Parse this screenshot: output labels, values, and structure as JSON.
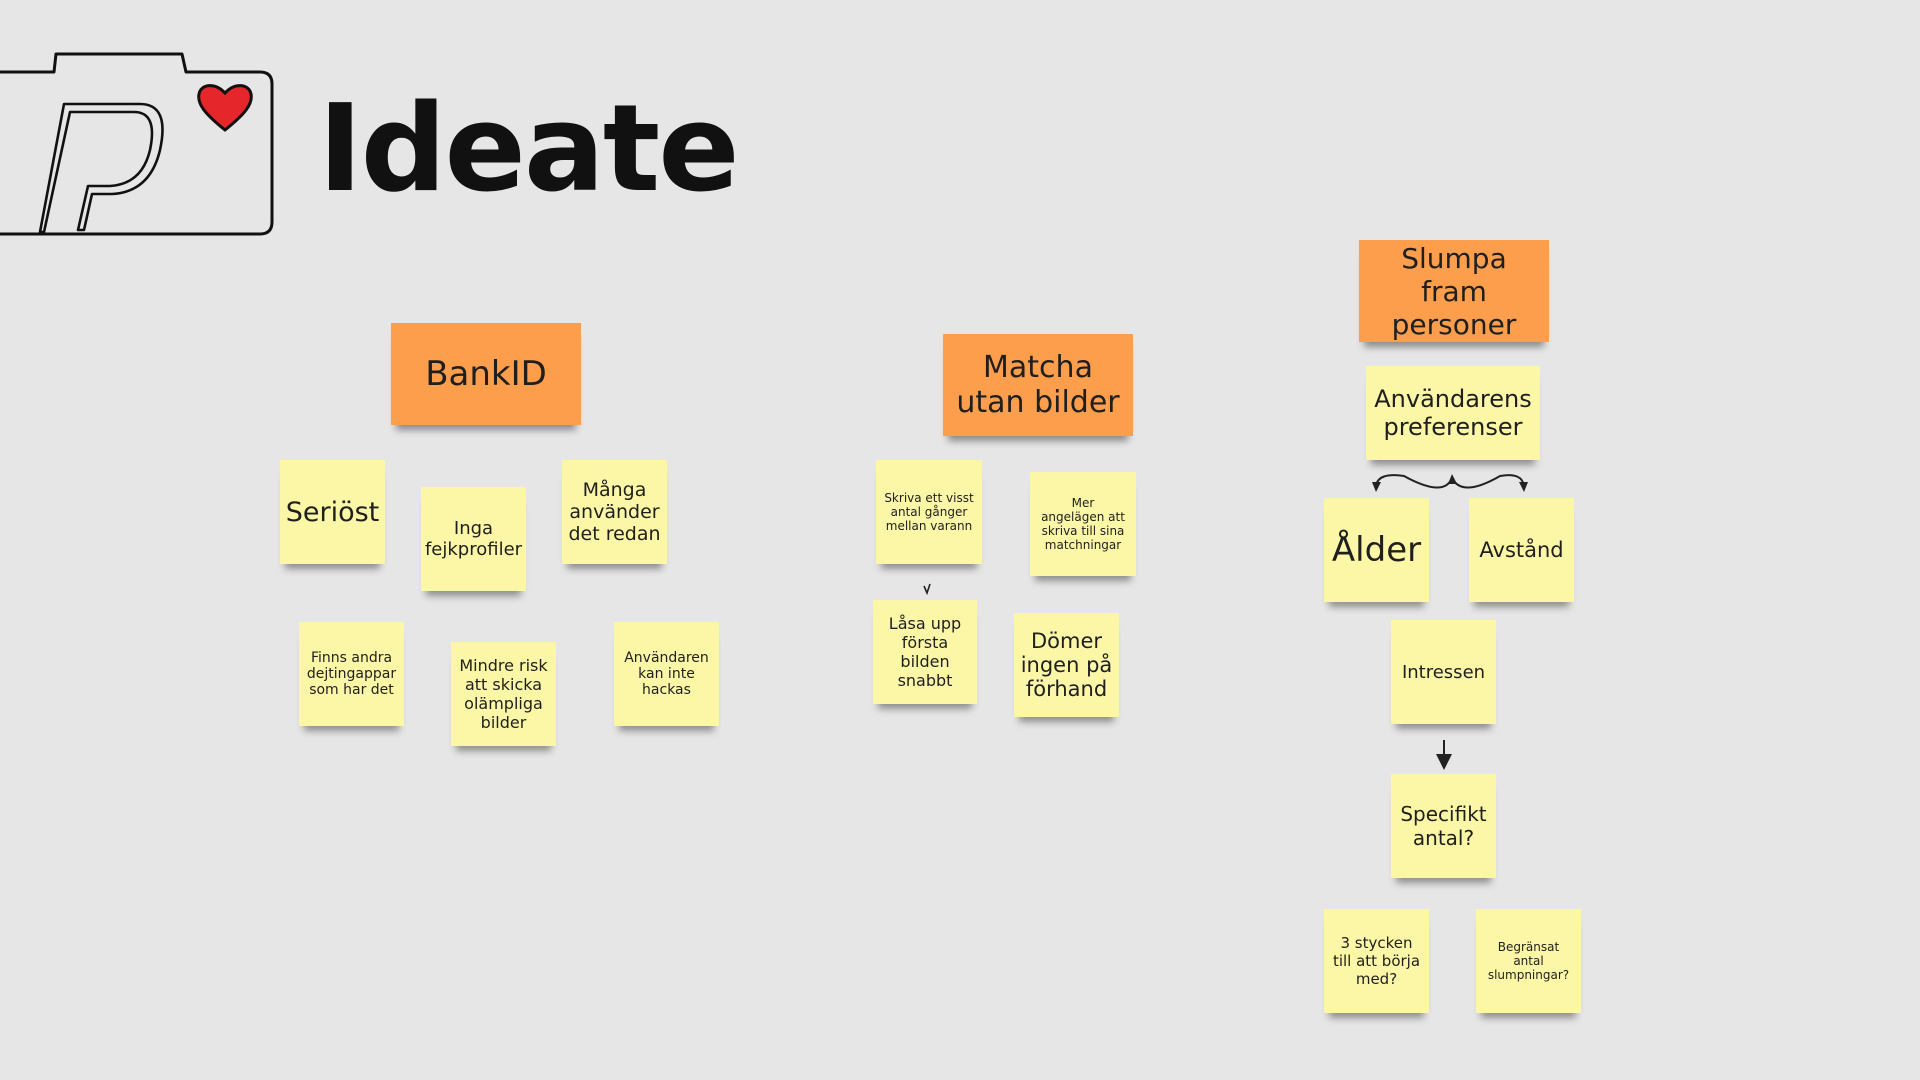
{
  "title": "Ideate",
  "logo": {
    "icon": "camera-heart-logo",
    "heart_color": "#e5262a"
  },
  "colors": {
    "background": "#e6e6e6",
    "yellow_note": "#fcf7a6",
    "orange_note": "#fd9e4c"
  },
  "clusters": {
    "bankid": {
      "header": "BankID",
      "notes": [
        "Seriöst",
        "Inga\nfejkprofiler",
        "Många\nanvänder\ndet redan",
        "Finns andra\ndejtingappar\nsom har det",
        "Mindre risk\natt skicka\nolämpliga\nbilder",
        "Användaren\nkan inte\nhackas"
      ]
    },
    "match": {
      "header": "Matcha\nutan bilder",
      "notes": [
        "Skriva ett visst\nantal gånger\nmellan varann",
        "Mer\nangelägen att\nskriva till sina\nmatchningar",
        "Låsa upp\nförsta\nbilden\nsnabbt",
        "Dömer\ningen på\nförhand"
      ]
    },
    "random": {
      "header": "Slumpa fram\npersoner",
      "notes": [
        "Användarens\npreferenser",
        "Ålder",
        "Avstånd",
        "Intressen",
        "Specifikt\nantal?",
        "3 stycken\ntill att börja\nmed?",
        "Begränsat\nantal\nslumpningar?"
      ]
    }
  }
}
